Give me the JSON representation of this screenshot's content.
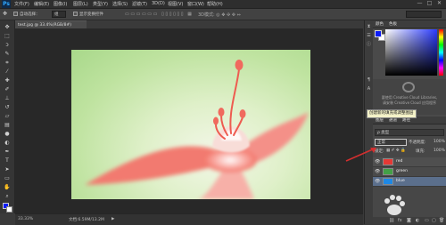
{
  "menubar": {
    "logo": "Ps",
    "items": [
      "文件(F)",
      "编辑(E)",
      "图像(I)",
      "图层(L)",
      "类型(Y)",
      "选择(S)",
      "滤镜(T)",
      "3D(D)",
      "视图(V)",
      "窗口(W)",
      "帮助(H)"
    ],
    "window_controls": [
      "—",
      "□",
      "✕"
    ]
  },
  "options": {
    "auto_select_label": "自动选择：",
    "auto_select_value": "组",
    "show_transform_label": "显示变换控件"
  },
  "document": {
    "tab_title": "test.jpg @ 33.4%(RGB/8#)",
    "zoom": "33.33%",
    "doc_info": "文档:6.59M/13.2M"
  },
  "panels": {
    "color_tabs": [
      "颜色",
      "色板"
    ],
    "library_line1": "要使用 Creative Cloud Libraries,",
    "library_line2": "请安装 Creative Cloud 应用程序",
    "tooltip": "创建新的填充或调整图层",
    "layers_tabs": [
      "图层",
      "通道",
      "路径"
    ],
    "search_placeholder": "ρ 类型",
    "blend_mode": "正常",
    "opacity_label": "不透明度:",
    "opacity_value": "100%",
    "lock_label": "锁定:",
    "fill_label": "填充:",
    "fill_value": "100%",
    "layers": [
      {
        "name": "red",
        "color": "#e53935"
      },
      {
        "name": "green",
        "color": "#43a047"
      },
      {
        "name": "blue",
        "color": "#1e88e5"
      }
    ]
  },
  "colors": {
    "foreground": "#0c1cf5",
    "background": "#ffffff",
    "accent_arrow": "#d32f2f"
  }
}
